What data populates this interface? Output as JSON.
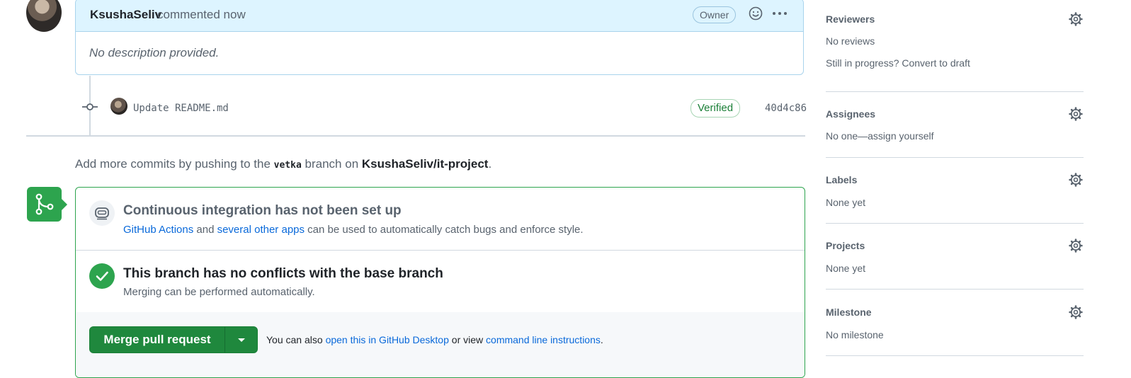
{
  "comment": {
    "author": "KsushaSeliv",
    "meta": "commented now",
    "badge": "Owner",
    "body": "No description provided."
  },
  "commit": {
    "message": "Update README.md",
    "verified": "Verified",
    "sha": "40d4c86"
  },
  "push_note": {
    "prefix": "Add more commits by pushing to the",
    "branch": "vetka",
    "middle": "branch on",
    "repo": "KsushaSeliv/it-project",
    "suffix": "."
  },
  "merge": {
    "ci_title": "Continuous integration has not been set up",
    "ci_link1": "GitHub Actions",
    "ci_and": "and",
    "ci_link2": "several other apps",
    "ci_rest": "can be used to automatically catch bugs and enforce style.",
    "conflict_title": "This branch has no conflicts with the base branch",
    "conflict_desc": "Merging can be performed automatically.",
    "button_label": "Merge pull request",
    "alt_prefix": "You can also",
    "alt_link1": "open this in GitHub Desktop",
    "alt_middle": "or view",
    "alt_link2": "command line instructions",
    "alt_suffix": "."
  },
  "sidebar": {
    "reviewers": {
      "title": "Reviewers",
      "value": "No reviews",
      "extra": "Still in progress? Convert to draft"
    },
    "assignees": {
      "title": "Assignees",
      "value": "No one—assign yourself"
    },
    "labels": {
      "title": "Labels",
      "value": "None yet"
    },
    "projects": {
      "title": "Projects",
      "value": "None yet"
    },
    "milestone": {
      "title": "Milestone",
      "value": "No milestone"
    }
  },
  "colors": {
    "accent_green": "#2da44e",
    "link_blue": "#0969da",
    "comment_header_bg": "#ddf4ff"
  },
  "icons": [
    "avatar",
    "smiley-icon",
    "kebab-icon",
    "commit-icon",
    "git-merge-icon",
    "robot-icon",
    "check-icon",
    "chevron-down-icon",
    "gear-icon"
  ]
}
